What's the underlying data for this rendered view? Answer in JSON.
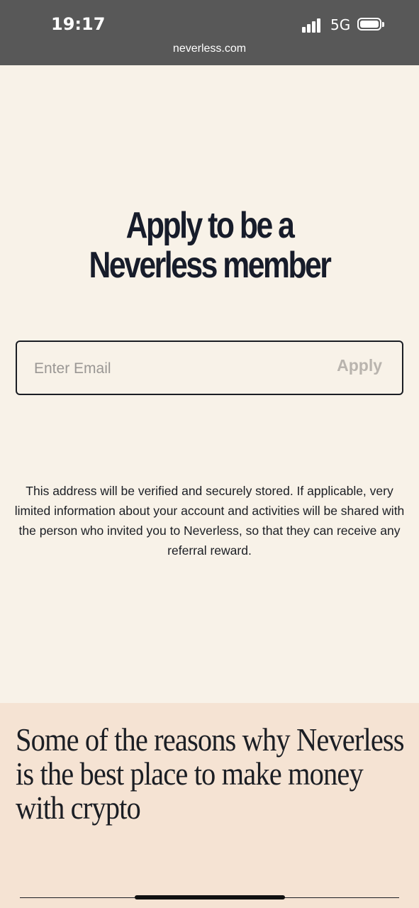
{
  "status_bar": {
    "time": "19:17",
    "network": "5G",
    "url": "neverless.com",
    "icons": [
      "signal-icon",
      "battery-icon"
    ]
  },
  "apply": {
    "headline_line1": "Apply to be a",
    "headline_line2": "Neverless member",
    "email_placeholder": "Enter Email",
    "email_value": "",
    "apply_label": "Apply"
  },
  "notice": {
    "text": "This address will be verified and securely stored. If applicable, very limited information about your account and activities will be shared with the person who invited you to Neverless, so that they can receive any referral reward."
  },
  "reasons": {
    "line1": "Some of the reasons why Neverless",
    "line2": "is the best place to make money",
    "line3": "with crypto"
  },
  "colors": {
    "page_bg": "#f8f2e8",
    "reasons_bg": "#f5e3d3",
    "status_bg": "#585858",
    "text": "#1b1e24"
  }
}
